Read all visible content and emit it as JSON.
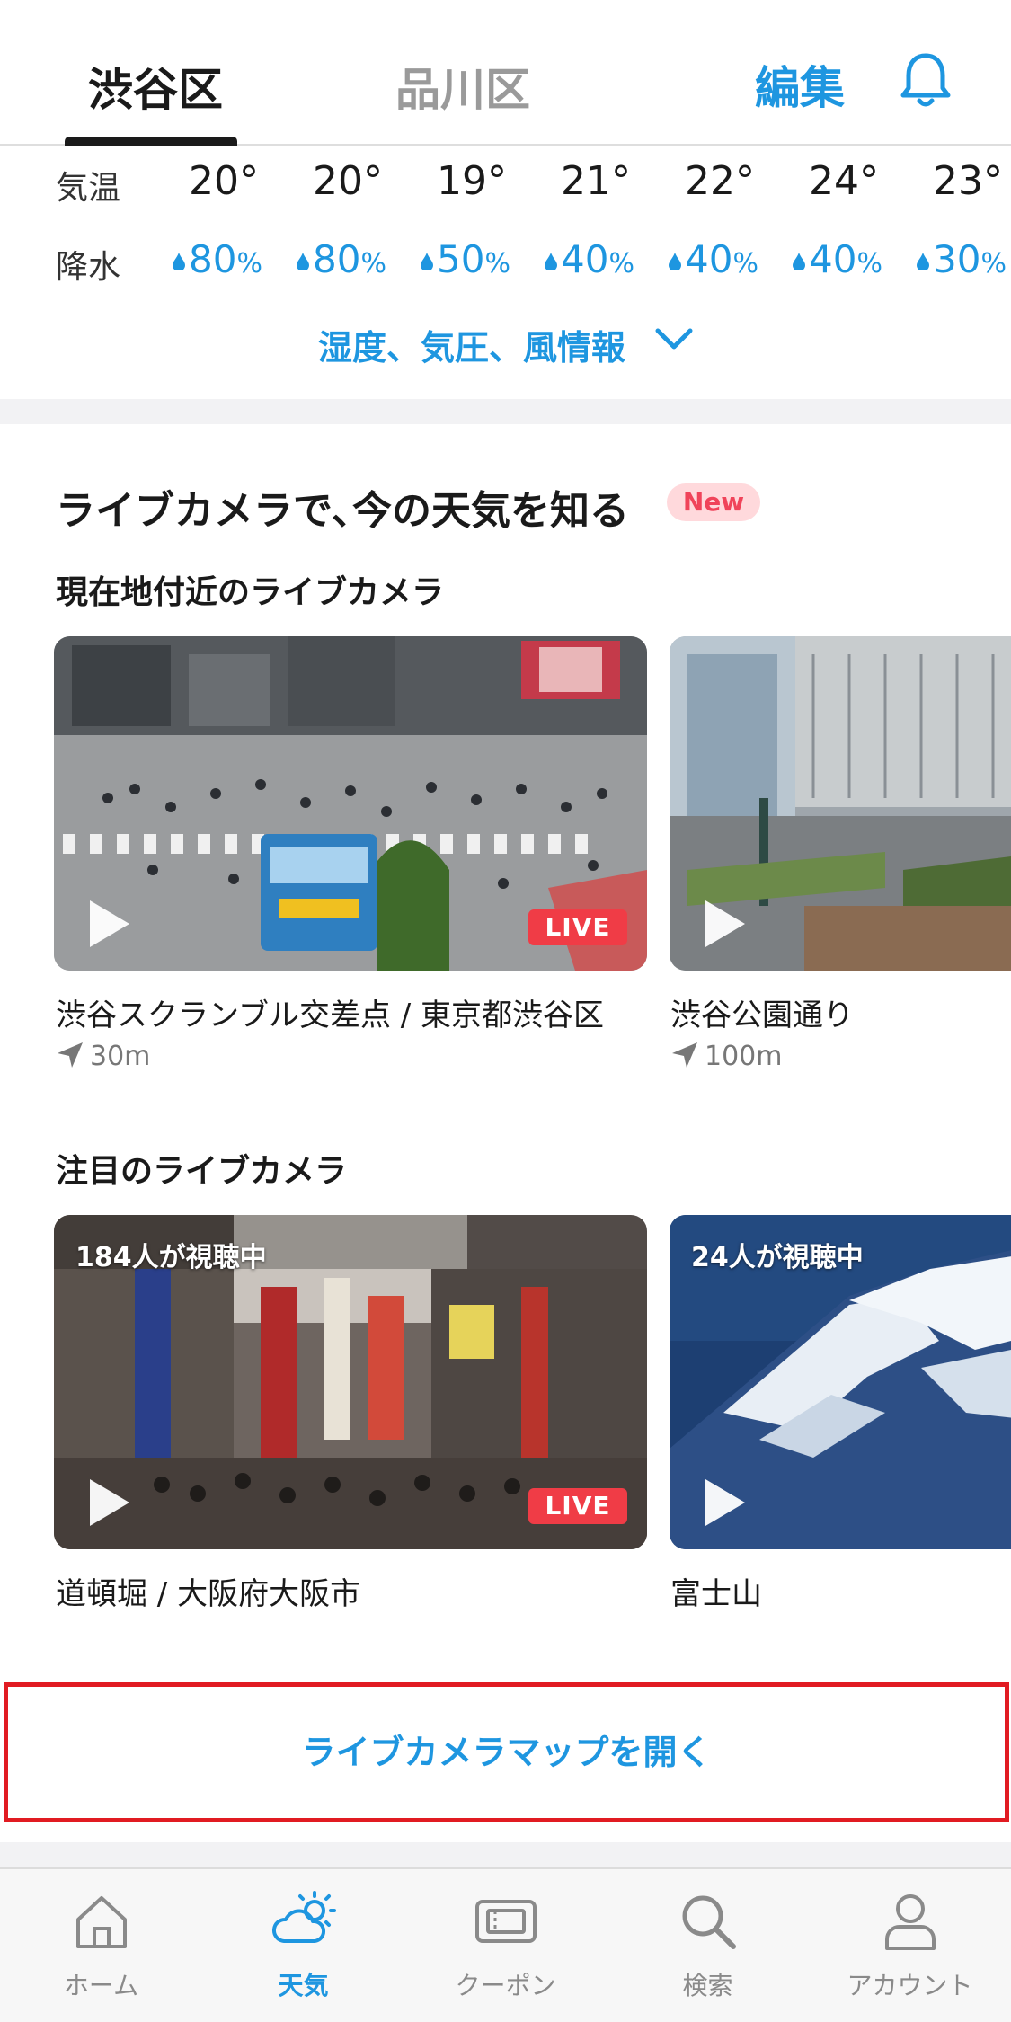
{
  "header": {
    "tabs": [
      {
        "label": "渋谷区",
        "active": true
      },
      {
        "label": "品川区",
        "active": false
      }
    ],
    "edit_label": "編集",
    "bell_icon": "bell-icon"
  },
  "weather": {
    "temp_label": "気温",
    "precip_label": "降水",
    "temps": [
      "20°",
      "20°",
      "19°",
      "21°",
      "22°",
      "24°",
      "23°"
    ],
    "precip": [
      "80",
      "80",
      "50",
      "40",
      "40",
      "40",
      "30"
    ],
    "precip_unit": "%",
    "more_label": "湿度、気圧、風情報",
    "accent": "#1e96e0"
  },
  "live_camera": {
    "title": "ライブカメラで､今の天気を知る",
    "new_badge": "New",
    "nearby_title": "現在地付近のライブカメラ",
    "nearby": [
      {
        "name": "渋谷スクランブル交差点 / 東京都渋谷区",
        "distance": "30m",
        "live": "LIVE"
      },
      {
        "name": "渋谷公園通り",
        "distance": "100m"
      }
    ],
    "featured_title": "注目のライブカメラ",
    "featured": [
      {
        "name": "道頓堀 / 大阪府大阪市",
        "viewers": "184人が視聴中",
        "live": "LIVE"
      },
      {
        "name": "富士山",
        "viewers": "24人が視聴中"
      }
    ],
    "map_button": "ライブカメラマップを開く"
  },
  "bottom_nav": [
    {
      "label": "ホーム",
      "icon": "home-icon"
    },
    {
      "label": "天気",
      "icon": "weather-icon",
      "active": true
    },
    {
      "label": "クーポン",
      "icon": "coupon-icon"
    },
    {
      "label": "検索",
      "icon": "search-icon"
    },
    {
      "label": "アカウント",
      "icon": "account-icon"
    }
  ]
}
